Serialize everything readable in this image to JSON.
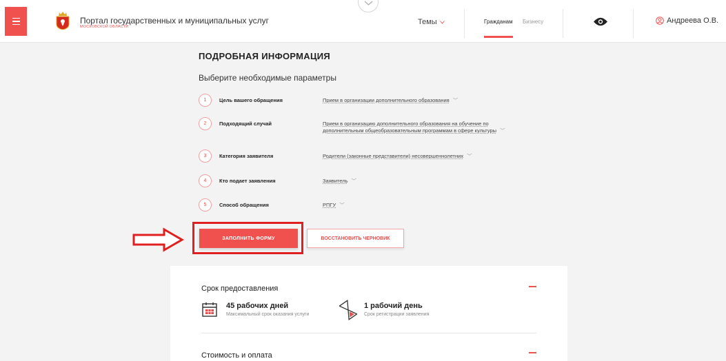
{
  "header": {
    "portal_title": "Портал государственных и муниципальных услуг",
    "portal_subtitle": "МОСКОВСКОЙ ОБЛАСТИ",
    "themes_label": "Темы",
    "tab_citizens": "Гражданам",
    "tab_business": "Бизнесу",
    "user_name": "Андреева О.В.",
    "accent_color": "#f0514f"
  },
  "main": {
    "title": "ПОДРОБНАЯ ИНФОРМАЦИЯ",
    "subtitle": "Выберите необходимые параметры",
    "params": [
      {
        "num": "1",
        "label": "Цель вашего обращения",
        "value": "Прием в организации дополнительного образования"
      },
      {
        "num": "2",
        "label": "Подходящий случай",
        "value_line1": "Прием в организацию дополнительного образования на обучение по",
        "value_line2": "дополнительным общеобразовательным программам в сфере культуры"
      },
      {
        "num": "3",
        "label": "Категория заявителя",
        "value": "Родители (законные представители) несовершеннолетних"
      },
      {
        "num": "4",
        "label": "Кто подает заявления",
        "value": "Заявитель"
      },
      {
        "num": "5",
        "label": "Способ обращения",
        "value": "РПГУ"
      }
    ],
    "btn_fill": "ЗАПОЛНИТЬ ФОРМУ",
    "btn_restore": "ВОССТАНОВИТЬ ЧЕРНОВИК"
  },
  "card": {
    "term_title": "Срок предоставления",
    "term1_main": "45 рабочих дней",
    "term1_sub": "Максимальный срок оказания услуги",
    "term2_main": "1 рабочий день",
    "term2_sub": "Срок регистрации заявления",
    "cost_title": "Стоимость и оплата"
  }
}
